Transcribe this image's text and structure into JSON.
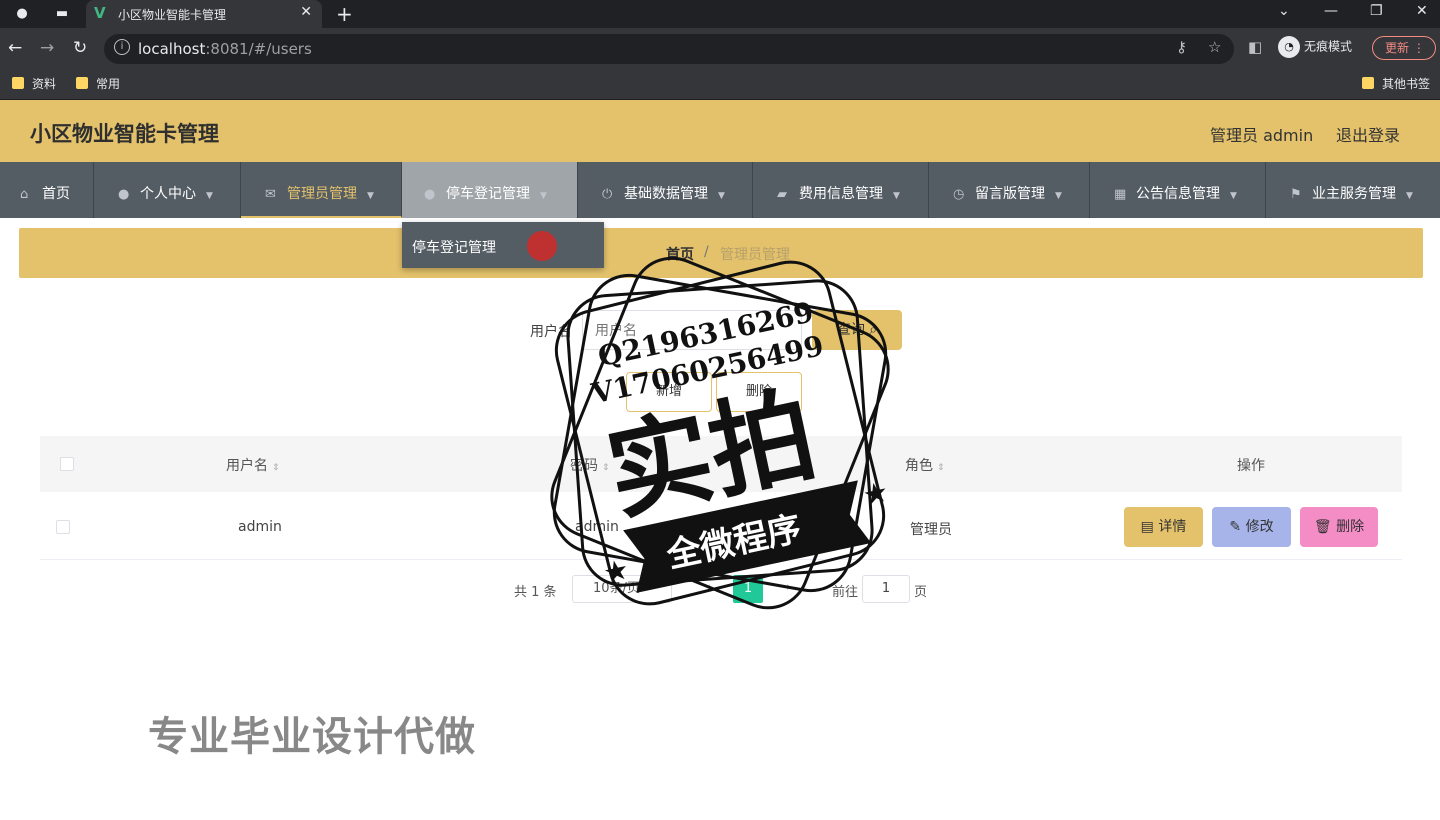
{
  "browser": {
    "tab_title": "小区物业智能卡管理",
    "url_host": "localhost",
    "url_rest": ":8081/#/users",
    "incognito_label": "无痕模式",
    "update_label": "更新",
    "bookmarks": [
      "资料",
      "常用"
    ],
    "other_bookmarks": "其他书签"
  },
  "header": {
    "title": "小区物业智能卡管理",
    "admin_label": "管理员 admin",
    "logout_label": "退出登录",
    "accent_color": "#e3c26b"
  },
  "menu": {
    "items": [
      {
        "label": "首页",
        "icon": "home-icon"
      },
      {
        "label": "个人中心",
        "icon": "user-icon"
      },
      {
        "label": "管理员管理",
        "icon": "message-icon"
      },
      {
        "label": "停车登记管理",
        "icon": "user-icon"
      },
      {
        "label": "基础数据管理",
        "icon": "power-icon"
      },
      {
        "label": "费用信息管理",
        "icon": "wallet-icon"
      },
      {
        "label": "留言版管理",
        "icon": "clock-icon"
      },
      {
        "label": "公告信息管理",
        "icon": "grid-icon"
      },
      {
        "label": "业主服务管理",
        "icon": "flag-icon"
      }
    ],
    "dropdown_item": "停车登记管理"
  },
  "breadcrumb": {
    "home": "首页",
    "separator": "/",
    "current": "管理员管理"
  },
  "search": {
    "label": "用户名",
    "placeholder": "用户名",
    "query_label": "查询"
  },
  "actions": {
    "add": "新增",
    "delete": "删除"
  },
  "table": {
    "headers": {
      "username": "用户名",
      "password": "密码",
      "role": "角色",
      "ops": "操作"
    },
    "rows": [
      {
        "username": "admin",
        "password": "admin",
        "role": "管理员"
      }
    ],
    "op_labels": {
      "detail": "详情",
      "edit": "修改",
      "delete": "删除"
    }
  },
  "pagination": {
    "total": "共 1 条",
    "page_size": "10条/页",
    "current": "1",
    "goto_prefix": "前往",
    "goto_value": "1",
    "goto_suffix": "页"
  },
  "stamp": {
    "line1": "Q2196316269",
    "line2": "V17060256499",
    "big": "实拍",
    "banner": "全微程序"
  },
  "watermark": "专业毕业设计代做"
}
